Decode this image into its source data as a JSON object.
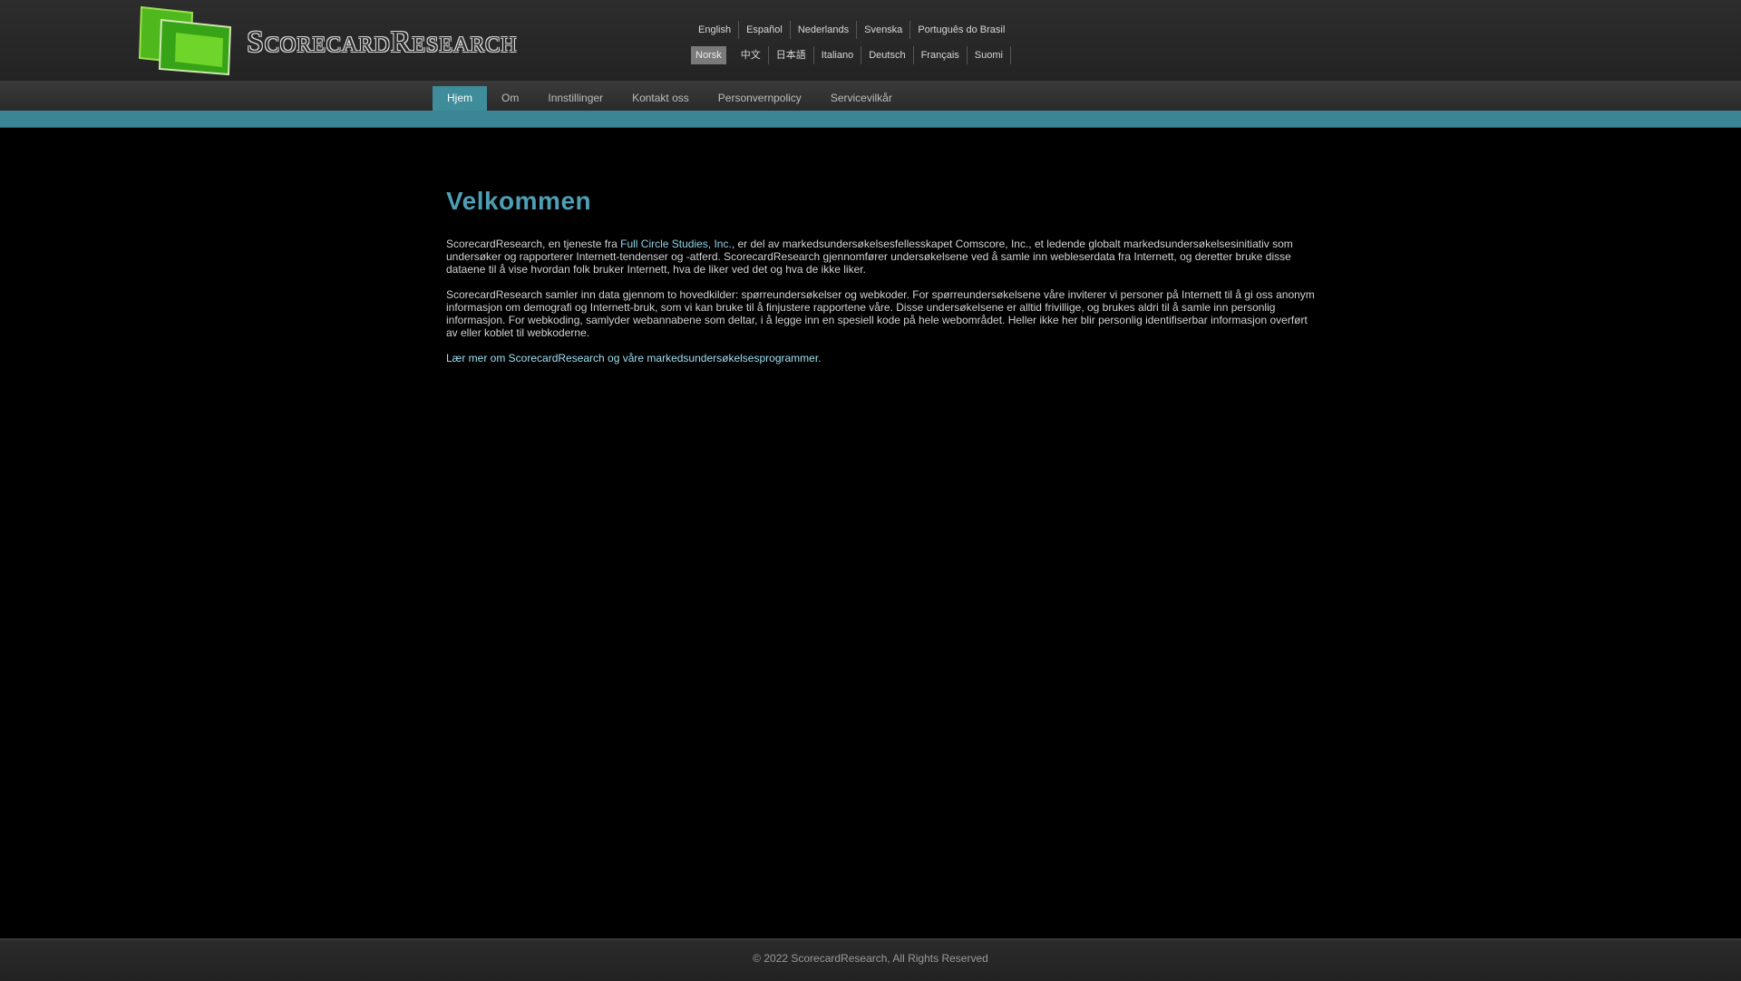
{
  "brand": {
    "name": "ScorecardResearch",
    "logo_colors": [
      "#5cc61f",
      "#2f8f14",
      "#9be052"
    ]
  },
  "languages": {
    "row1": [
      "English",
      "Español",
      "Nederlands",
      "Svenska",
      "Português do Brasil"
    ],
    "row2": [
      "Norsk",
      "中文",
      "日本語",
      "Italiano",
      "Deutsch",
      "Français",
      "Suomi"
    ],
    "selected": "Norsk"
  },
  "nav": {
    "items": [
      "Hjem",
      "Om",
      "Innstillinger",
      "Kontakt oss",
      "Personvernpolicy",
      "Servicevilkår"
    ],
    "active": "Hjem"
  },
  "content": {
    "title": "Velkommen",
    "p1_a": "ScorecardResearch, en tjeneste fra ",
    "p1_link": "Full Circle Studies, Inc.",
    "p1_b": ", er del av markedsundersøkelsesfellesskapet Comscore, Inc., et ledende globalt markedsundersøkelsesinitiativ som undersøker og rapporterer Internett-tendenser og -atferd. ScorecardResearch gjennomfører undersøkelsene ved å samle inn webleserdata fra Internett, og deretter bruke disse dataene til å vise hvordan folk bruker Internett, hva de liker ved det og hva de ikke liker.",
    "p2": "ScorecardResearch samler inn data gjennom to hovedkilder: spørreundersøkelser og webkoder. For spørreundersøkelsene våre inviterer vi personer på Internett til å gi oss anonym informasjon om demografi og Internett-bruk, som vi kan bruke til å finjustere rapportene våre. Disse undersøkelsene er alltid frivillige, og brukes aldri til å samle inn personlig informasjon. For webkoding, samlyder webannabene som deltar, i å legge inn en spesiell kode på hele webområdet. Heller ikke her blir personlig identifiserbar informasjon overført av eller koblet til webkoderne.",
    "link_text": "Lær mer om ScorecardResearch og våre markedsundersøkelsesprogrammer."
  },
  "footer": {
    "copyright": "© 2022 ScorecardResearch, All Rights Reserved"
  },
  "colors": {
    "accent": "#3b8596",
    "title": "#4e9fb4",
    "link": "#9fdff0"
  }
}
